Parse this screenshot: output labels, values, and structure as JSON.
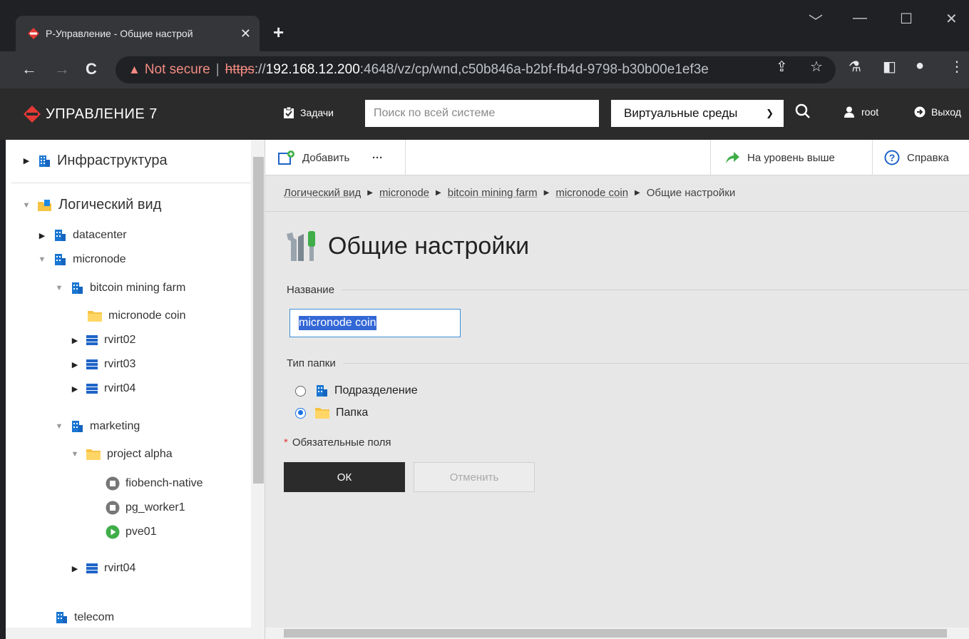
{
  "browser": {
    "tab_title": "Р-Управление - Общие настрой",
    "new_tab": "+",
    "url_warning": "Not secure",
    "url_scheme": "https",
    "url_sep": "://",
    "url_host": "192.168.12.200",
    "url_path": ":4648/vz/cp/wnd,c50b846a-b2bf-fb4d-9798-b30b00e1ef3e"
  },
  "header": {
    "logo": "УПРАВЛЕНИЕ 7",
    "tasks": "Задачи",
    "search_placeholder": "Поиск по всей системе",
    "scope_select": "Виртуальные среды",
    "user": "root",
    "logout": "Выход"
  },
  "tree": {
    "infrastructure": "Инфраструктура",
    "logical_view": "Логический вид",
    "datacenter": "datacenter",
    "micronode": "micronode",
    "bitcoin_farm": "bitcoin mining farm",
    "micronode_coin": "micronode coin",
    "rvirt02": "rvirt02",
    "rvirt03": "rvirt03",
    "rvirt04a": "rvirt04",
    "marketing": "marketing",
    "project_alpha": "project alpha",
    "fiobench": "fiobench-native",
    "pg_worker": "pg_worker1",
    "pve01": "pve01",
    "rvirt04b": "rvirt04",
    "telecom": "telecom"
  },
  "toolbar": {
    "add": "Добавить",
    "more": "···",
    "up_level": "На уровень выше",
    "help": "Справка"
  },
  "breadcrumb": [
    "Логический вид",
    "micronode",
    "bitcoin mining farm",
    "micronode coin",
    "Общие настройки"
  ],
  "form": {
    "title": "Общие настройки",
    "name_label": "Название",
    "name_value": "micronode coin",
    "folder_type_label": "Тип папки",
    "option_division": "Подразделение",
    "option_folder": "Папка",
    "selected_option": "Папка",
    "required_note": "Обязательные поля",
    "ok": "ОК",
    "cancel": "Отменить"
  },
  "colors": {
    "brand_red": "#e53935",
    "header_bg": "#2b2b2b",
    "accent_blue": "#1a73e8"
  }
}
